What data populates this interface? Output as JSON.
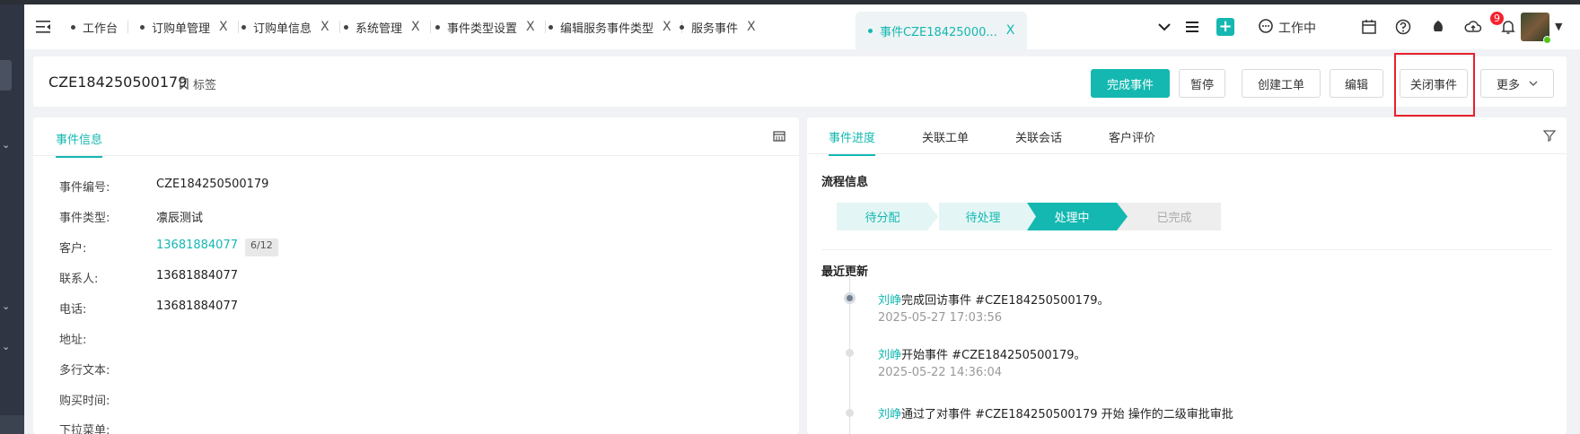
{
  "tabs": [
    {
      "label": "工作台",
      "closable": false
    },
    {
      "label": "订购单管理",
      "closable": true
    },
    {
      "label": "订购单信息",
      "closable": true
    },
    {
      "label": "系统管理",
      "closable": true
    },
    {
      "label": "事件类型设置",
      "closable": true
    },
    {
      "label": "编辑服务事件类型",
      "closable": true
    },
    {
      "label": "服务事件",
      "closable": true
    },
    {
      "label": "事件CZE18425000...",
      "closable": true,
      "active": true
    }
  ],
  "tab_close_glyph": "X",
  "toolbar": {
    "status_label": "工作中",
    "notification_count": "9",
    "icons": [
      "chevron-down-icon",
      "list-icon",
      "add-icon",
      "chat-status-icon",
      "calendar-icon",
      "help-icon",
      "skin-icon",
      "cloud-upload-icon",
      "bell-icon"
    ]
  },
  "header": {
    "event_id": "CZE184250500179",
    "tag_label": "标签",
    "buttons": {
      "complete": "完成事件",
      "pause": "暂停",
      "create_ticket": "创建工单",
      "edit": "编辑",
      "close_event": "关闭事件",
      "more": "更多"
    }
  },
  "left_panel": {
    "tab_label": "事件信息",
    "fields": [
      {
        "label": "事件编号:",
        "value": "CZE184250500179"
      },
      {
        "label": "事件类型:",
        "value": "凛辰测试"
      },
      {
        "label": "客户:",
        "value": "13681884077",
        "extra": "6/12",
        "link": true
      },
      {
        "label": "联系人:",
        "value": "13681884077"
      },
      {
        "label": "电话:",
        "value": "13681884077"
      },
      {
        "label": "地址:",
        "value": ""
      },
      {
        "label": "多行文本:",
        "value": ""
      },
      {
        "label": "购买时间:",
        "value": ""
      },
      {
        "label": "下拉菜单:",
        "value": ""
      }
    ]
  },
  "right_panel": {
    "tabs": [
      "事件进度",
      "关联工单",
      "关联会话",
      "客户评价"
    ],
    "flow_title": "流程信息",
    "steps": [
      "待分配",
      "待处理",
      "处理中",
      "已完成"
    ],
    "current_step": 2,
    "recent_title": "最近更新",
    "updates": [
      {
        "who": "刘峥",
        "text": "完成回访事件 #CZE184250500179。",
        "time": "2025-05-27 17:03:56"
      },
      {
        "who": "刘峥",
        "text": "开始事件 #CZE184250500179。",
        "time": "2025-05-22 14:36:04"
      },
      {
        "who": "刘峥",
        "text": "通过了对事件 #CZE184250500179 开始 操作的二级审批审批",
        "time": ""
      }
    ]
  },
  "colors": {
    "accent": "#14b8b1",
    "highlight": "#e8202a",
    "sidebar": "#2f3542"
  }
}
